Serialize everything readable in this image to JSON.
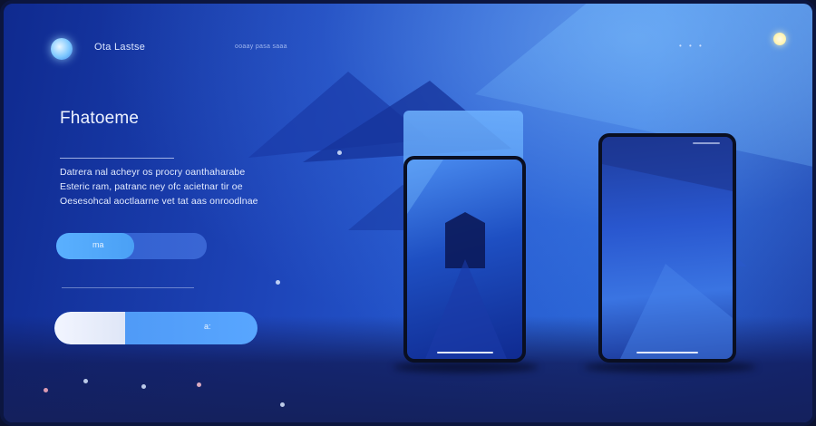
{
  "header": {
    "brand": "Ota Lastse",
    "nav": "ooaay pasa saaa",
    "right_dots": "• • •"
  },
  "hero": {
    "headline": "Fhatoeme",
    "body_lines": [
      "Datrera nal acheyr os procry oanthaharabe",
      "Esteric ram, patranc ney ofc acietnar tir oe",
      "Oesesohcal aoctlaarne vet tat aas onroodlnae"
    ]
  },
  "buttons": {
    "primary_label": "ma",
    "secondary_label": "a:"
  },
  "colors": {
    "accent": "#4aa0f5",
    "background": "#1d44b8",
    "text": "#eef3ff"
  }
}
